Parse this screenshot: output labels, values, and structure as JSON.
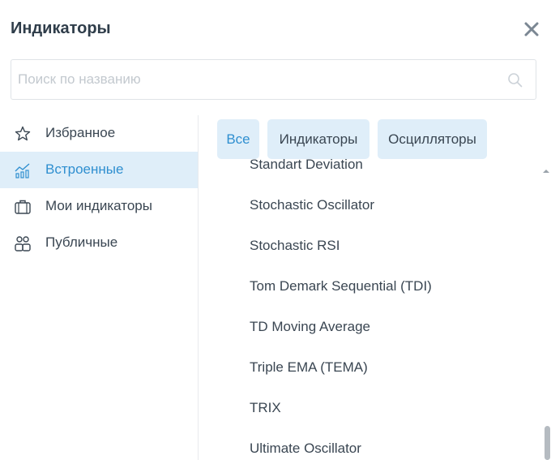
{
  "dialog": {
    "title": "Индикаторы"
  },
  "search": {
    "placeholder": "Поиск по названию"
  },
  "sidebar": {
    "items": [
      {
        "label": "Избранное",
        "icon": "star-icon"
      },
      {
        "label": "Встроенные",
        "icon": "chart-icon",
        "active": true
      },
      {
        "label": "Мои индикаторы",
        "icon": "briefcase-icon"
      },
      {
        "label": "Публичные",
        "icon": "users-icon"
      }
    ]
  },
  "tabs": [
    {
      "label": "Все",
      "active": true
    },
    {
      "label": "Индикаторы"
    },
    {
      "label": "Осцилляторы"
    }
  ],
  "list": {
    "items": [
      "Standart Deviation",
      "Stochastic Oscillator",
      "Stochastic RSI",
      "Tom Demark Sequential (TDI)",
      "TD Moving Average",
      "Triple EMA (TEMA)",
      "TRIX",
      "Ultimate Oscillator"
    ]
  },
  "colors": {
    "accent": "#2f8fd0",
    "active_bg": "#dfeef9",
    "text": "#3a4652"
  }
}
